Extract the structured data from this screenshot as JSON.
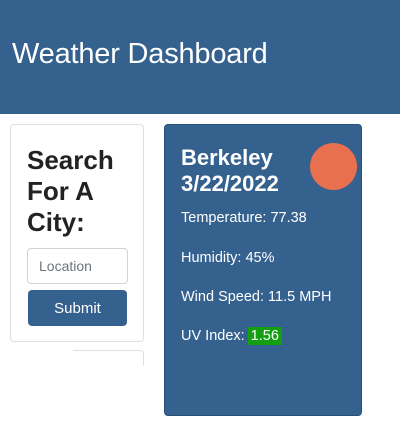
{
  "header": {
    "title": "Weather Dashboard"
  },
  "search": {
    "heading": "Search For A City:",
    "placeholder": "Location",
    "submit_label": "Submit"
  },
  "current_weather": {
    "city": "Berkeley",
    "date": "3/22/2022",
    "icon": "sun-icon",
    "icon_color": "#e9704f",
    "temperature": "Temperature: 77.38",
    "humidity": "Humidity: 45%",
    "wind_speed": "Wind Speed: 11.5 MPH",
    "uv_label": "UV Index:",
    "uv_value": "1.56",
    "uv_color": "#12a012"
  },
  "colors": {
    "primary": "#35618f",
    "background": "#ffffff"
  }
}
